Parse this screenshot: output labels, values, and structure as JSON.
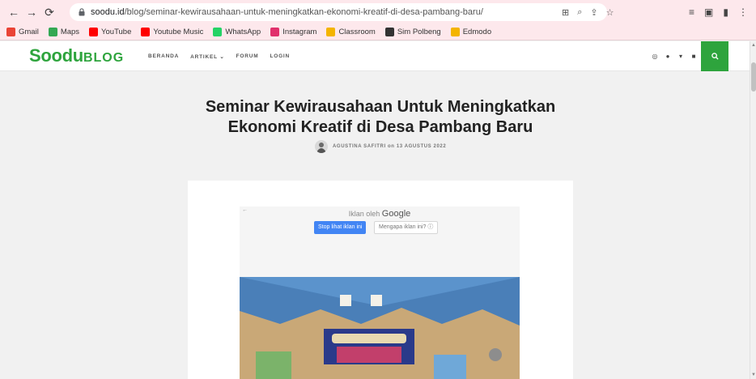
{
  "browser": {
    "url_host": "soodu.id",
    "url_path": "/blog/seminar-kewirausahaan-untuk-meningkatkan-ekonomi-kreatif-di-desa-pambang-baru/"
  },
  "bookmarks": [
    {
      "label": "Gmail",
      "icon": "gmail-icon",
      "color": "#ea4335"
    },
    {
      "label": "Maps",
      "icon": "maps-icon",
      "color": "#34a853"
    },
    {
      "label": "YouTube",
      "icon": "youtube-icon",
      "color": "#ff0000"
    },
    {
      "label": "Youtube Music",
      "icon": "youtube-music-icon",
      "color": "#ff0000"
    },
    {
      "label": "WhatsApp",
      "icon": "whatsapp-icon",
      "color": "#25d366"
    },
    {
      "label": "Instagram",
      "icon": "instagram-icon",
      "color": "#e1306c"
    },
    {
      "label": "Classroom",
      "icon": "classroom-icon",
      "color": "#f4b400"
    },
    {
      "label": "Sim Polbeng",
      "icon": "sim-polbeng-icon",
      "color": "#333333"
    },
    {
      "label": "Edmodo",
      "icon": "edmodo-icon",
      "color": "#f4b400"
    }
  ],
  "site": {
    "logo_main": "Soodu",
    "logo_sub": "BLOG",
    "brand_color": "#2ea43d",
    "nav": [
      "BERANDA",
      "ARTIKEL ⌄",
      "FORUM",
      "LOGIN"
    ],
    "social_icons": [
      "instagram-icon",
      "facebook-icon",
      "twitter-icon",
      "youtube-icon"
    ]
  },
  "article": {
    "title_line1": "Seminar Kewirausahaan Untuk Meningkatkan",
    "title_line2": "Ekonomi Kreatif di Desa Pambang Baru",
    "author": "AGUSTINA SAFITRI",
    "date_prefix": "on",
    "date": "13 AGUSTUS 2022"
  },
  "ad": {
    "label": "Iklan oleh",
    "google": "Google",
    "stop_button": "Stop lihat iklan ini",
    "why_button": "Mengapa iklan ini? ⓘ"
  }
}
